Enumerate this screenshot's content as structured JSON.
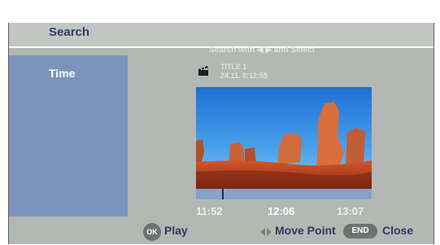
{
  "header": {
    "title": "Search"
  },
  "menu": {
    "items": [
      {
        "label": "Time"
      }
    ]
  },
  "hint": "Search with ◀ ▶ and Select",
  "title_info": {
    "icon": "clapperboard-icon",
    "name": "TITLE 1",
    "date": "24.11.  0:12:55"
  },
  "preview": {
    "icon": "canyon-thumbnail",
    "position_fraction": 0.15
  },
  "timeline": {
    "prev": "11:52",
    "current": "12:06",
    "next": "13:07"
  },
  "footer": {
    "ok_key": "OK",
    "play_label": "Play",
    "move_icon": "left-right-arrows-icon",
    "move_label": "Move Point",
    "end_key": "END",
    "close_label": "Close"
  },
  "colors": {
    "panel": "#b3b8b4",
    "header": "#c2c6c2",
    "menu": "#7a94bc",
    "timeline": "#86a2c8",
    "text_dark": "#2e3766"
  }
}
